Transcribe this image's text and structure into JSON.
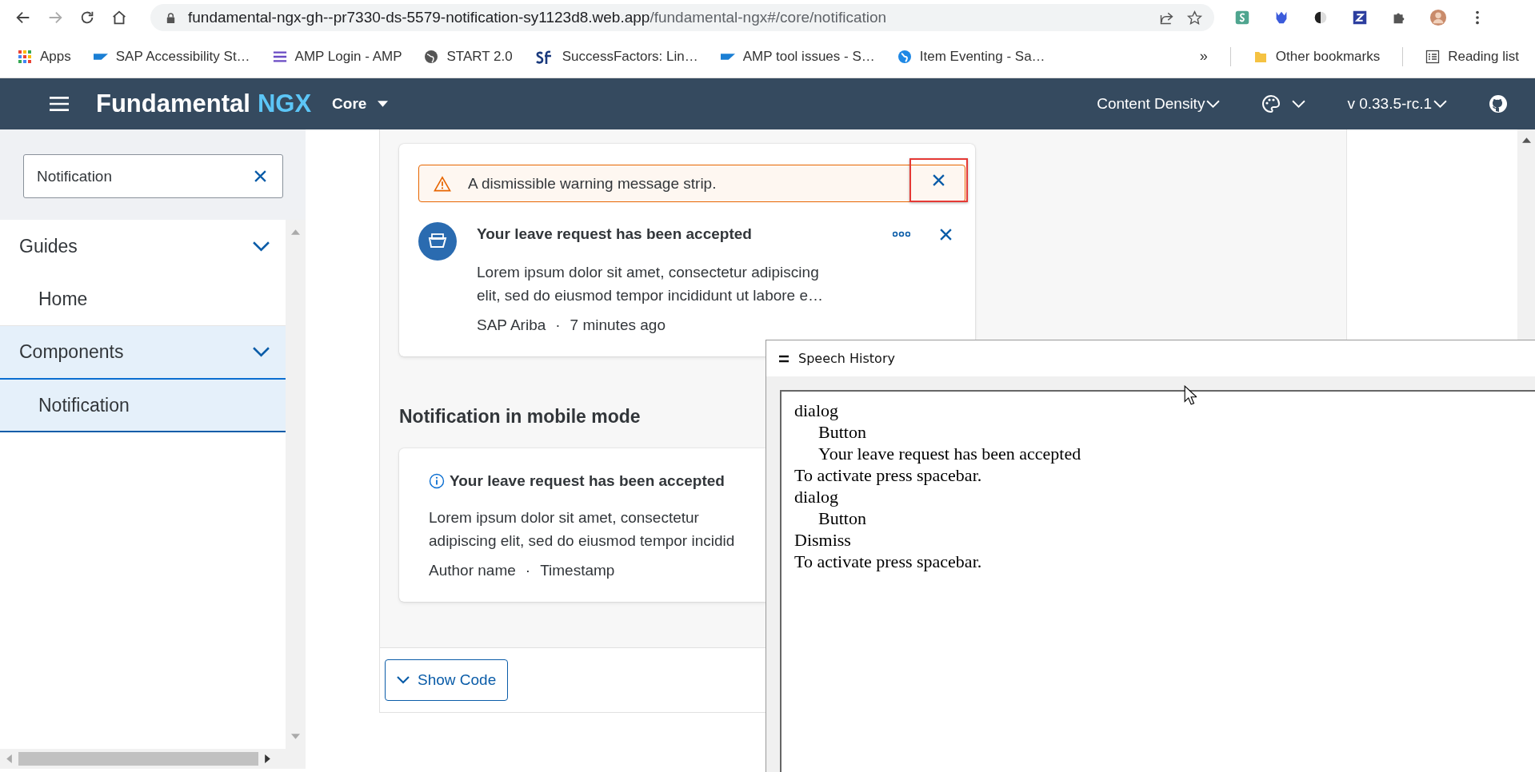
{
  "browser": {
    "url_host": "fundamental-ngx-gh--pr7330-ds-5579-notification-sy1123d8.web.app",
    "url_path": "/fundamental-ngx#/core/notification",
    "bookmarks": [
      {
        "label": "Apps",
        "kind": "apps"
      },
      {
        "label": "SAP Accessibility St…",
        "kind": "sap"
      },
      {
        "label": "AMP Login - AMP",
        "kind": "lines"
      },
      {
        "label": "START 2.0",
        "kind": "globe"
      },
      {
        "label": "SuccessFactors: Lin…",
        "kind": "sf"
      },
      {
        "label": "AMP tool issues - S…",
        "kind": "sap"
      },
      {
        "label": "Item Eventing - Sa…",
        "kind": "earth"
      }
    ],
    "overflow": "»",
    "other_bookmarks": "Other bookmarks",
    "reading_list": "Reading list"
  },
  "header": {
    "logo_text": "Fundamental",
    "logo_accent": "NGX",
    "product": "Core",
    "content_density": "Content Density",
    "version": "v 0.33.5-rc.1"
  },
  "sidebar": {
    "search": {
      "value": "Notification"
    },
    "items": [
      {
        "label": "Guides",
        "expanded": true,
        "selected": false,
        "children": [
          {
            "label": "Home",
            "selected": false
          }
        ]
      },
      {
        "label": "Components",
        "expanded": true,
        "selected": true,
        "children": [
          {
            "label": "Notification",
            "selected": true
          }
        ]
      }
    ]
  },
  "main": {
    "strip": {
      "text": "A dismissible warning message strip.",
      "close_focused": true
    },
    "notification": {
      "title": "Your leave request has been accepted",
      "body": [
        "Lorem ipsum dolor sit amet, consectetur adipiscing",
        "elit, sed do eiusmod tempor incididunt ut labore e…"
      ],
      "source": "SAP Ariba",
      "separator": "·",
      "time": "7 minutes ago"
    },
    "mobile_heading": "Notification in mobile mode",
    "mobile_notification": {
      "title": "Your leave request has been accepted",
      "body": [
        "Lorem ipsum dolor sit amet, consectetur",
        "adipiscing elit, sed do eiusmod tempor incidid"
      ],
      "source": "Author name",
      "separator": "·",
      "time": "Timestamp"
    },
    "show_code": "Show Code"
  },
  "speech_history": {
    "title": "Speech History",
    "lines": [
      {
        "text": "dialog",
        "children": [
          {
            "text": "Button"
          },
          {
            "text": "Your leave request has been accepted"
          }
        ]
      },
      {
        "text": "To activate press spacebar."
      },
      {
        "text": "dialog",
        "children": [
          {
            "text": "Button"
          }
        ]
      },
      {
        "text": "Dismiss"
      },
      {
        "text": "To activate press spacebar."
      }
    ]
  }
}
